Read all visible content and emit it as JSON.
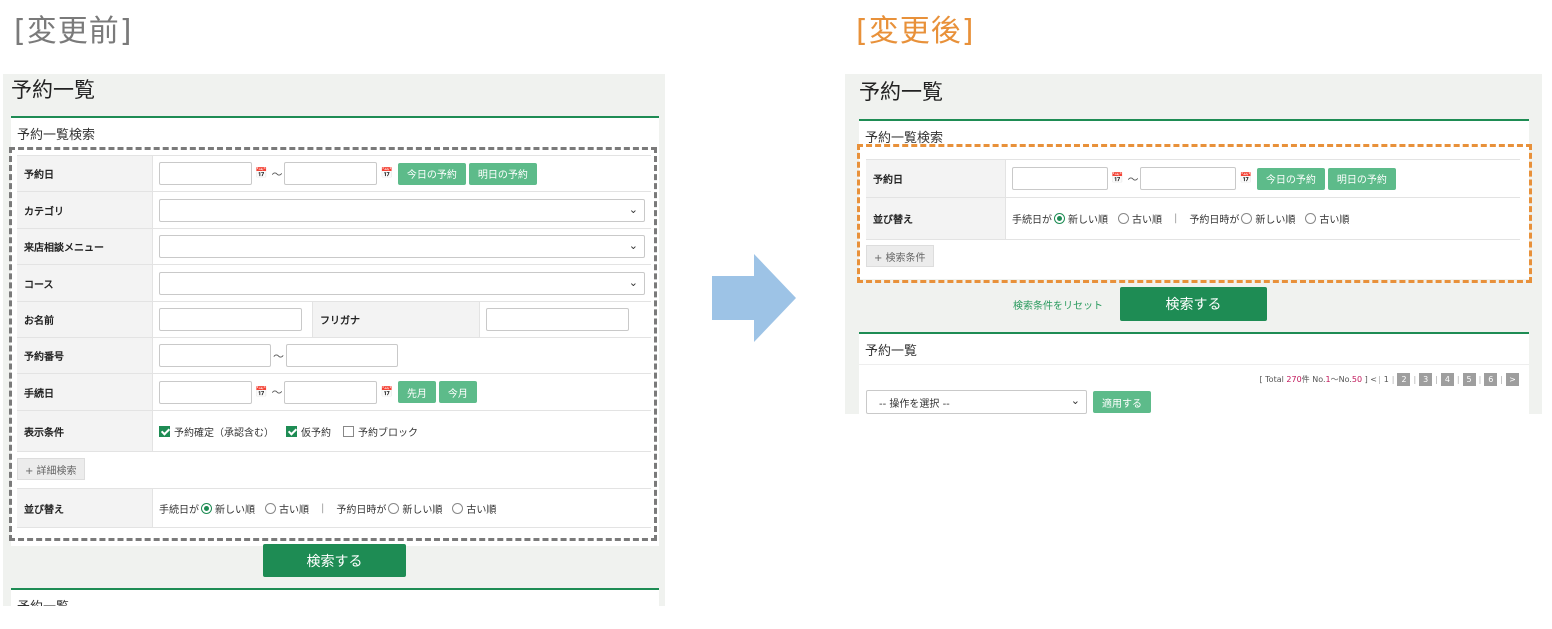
{
  "captions": {
    "before": "[変更前]",
    "after": "[変更後]"
  },
  "before": {
    "page_title": "予約一覧",
    "search_card_title": "予約一覧検索",
    "rows": {
      "reserve_date": "予約日",
      "category": "カテゴリ",
      "consult_menu": "来店相談メニュー",
      "course": "コース",
      "name": "お名前",
      "furigana": "フリガナ",
      "reserve_no": "予約番号",
      "proc_date": "手続日",
      "display_cond": "表示条件",
      "sort": "並び替え"
    },
    "tilde": "〜",
    "calendar_icon": "calendar-icon",
    "btn_today": "今日の予約",
    "btn_tomorrow": "明日の予約",
    "btn_last_month": "先月",
    "btn_this_month": "今月",
    "cond_confirmed": "予約確定（承認含む）",
    "cond_tentative": "仮予約",
    "cond_block": "予約ブロック",
    "detail_search": "+ 詳細検索",
    "sort_proc_label": "手続日が",
    "sort_newest": "新しい順",
    "sort_oldest": "古い順",
    "sort_sep": "|",
    "sort_date_label": "予約日時が",
    "search_button": "検索する",
    "list_card_title": "予約一覧"
  },
  "arrow": {
    "color": "#9dc3e6"
  },
  "after": {
    "page_title": "予約一覧",
    "search_card_title": "予約一覧検索",
    "rows": {
      "reserve_date": "予約日",
      "sort": "並び替え"
    },
    "tilde": "〜",
    "btn_today": "今日の予約",
    "btn_tomorrow": "明日の予約",
    "sort_proc_label": "手続日が",
    "sort_newest": "新しい順",
    "sort_oldest": "古い順",
    "sort_sep": "|",
    "sort_date_label": "予約日時が",
    "search_conditions_btn": "+ 検索条件",
    "reset_link": "検索条件をリセット",
    "search_button": "検索する",
    "list_card_title": "予約一覧",
    "pager": {
      "open": "[ Total",
      "total": "270",
      "ken": "件 No.",
      "from": "1",
      "wave": "〜No.",
      "to": "50",
      "close": "]",
      "prev": "<",
      "current": "1",
      "pages": [
        "2",
        "3",
        "4",
        "5",
        "6"
      ],
      "next": ">"
    },
    "action_select": "-- 操作を選択 --",
    "apply_button": "適用する"
  },
  "colors": {
    "accent_green": "#1e8c54",
    "button_green": "#5dbb8a",
    "before_dash": "#7a7a7a",
    "after_dash": "#e8913a"
  }
}
